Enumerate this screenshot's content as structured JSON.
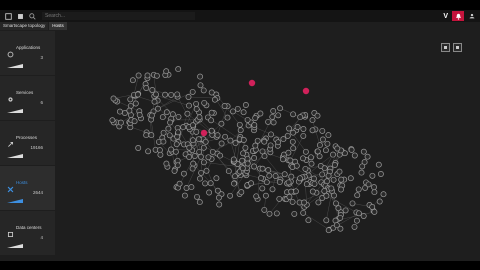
{
  "topbar": {
    "search_placeholder": "Search...",
    "brand": "V"
  },
  "tabs": [
    {
      "label": "Smartscape topology"
    },
    {
      "label": "Hosts"
    }
  ],
  "sidebar": {
    "cards": [
      {
        "label": "Applications",
        "value": "3"
      },
      {
        "label": "Services",
        "value": "6"
      },
      {
        "label": "Processes",
        "value": "19166"
      },
      {
        "label": "Hosts",
        "value": "2644"
      },
      {
        "label": "Data centers",
        "value": "4"
      }
    ]
  },
  "colors": {
    "alert": "#c4143c",
    "accent": "#3d8fe0",
    "node": "#9a9a9a",
    "highlight": "#d0215a"
  }
}
